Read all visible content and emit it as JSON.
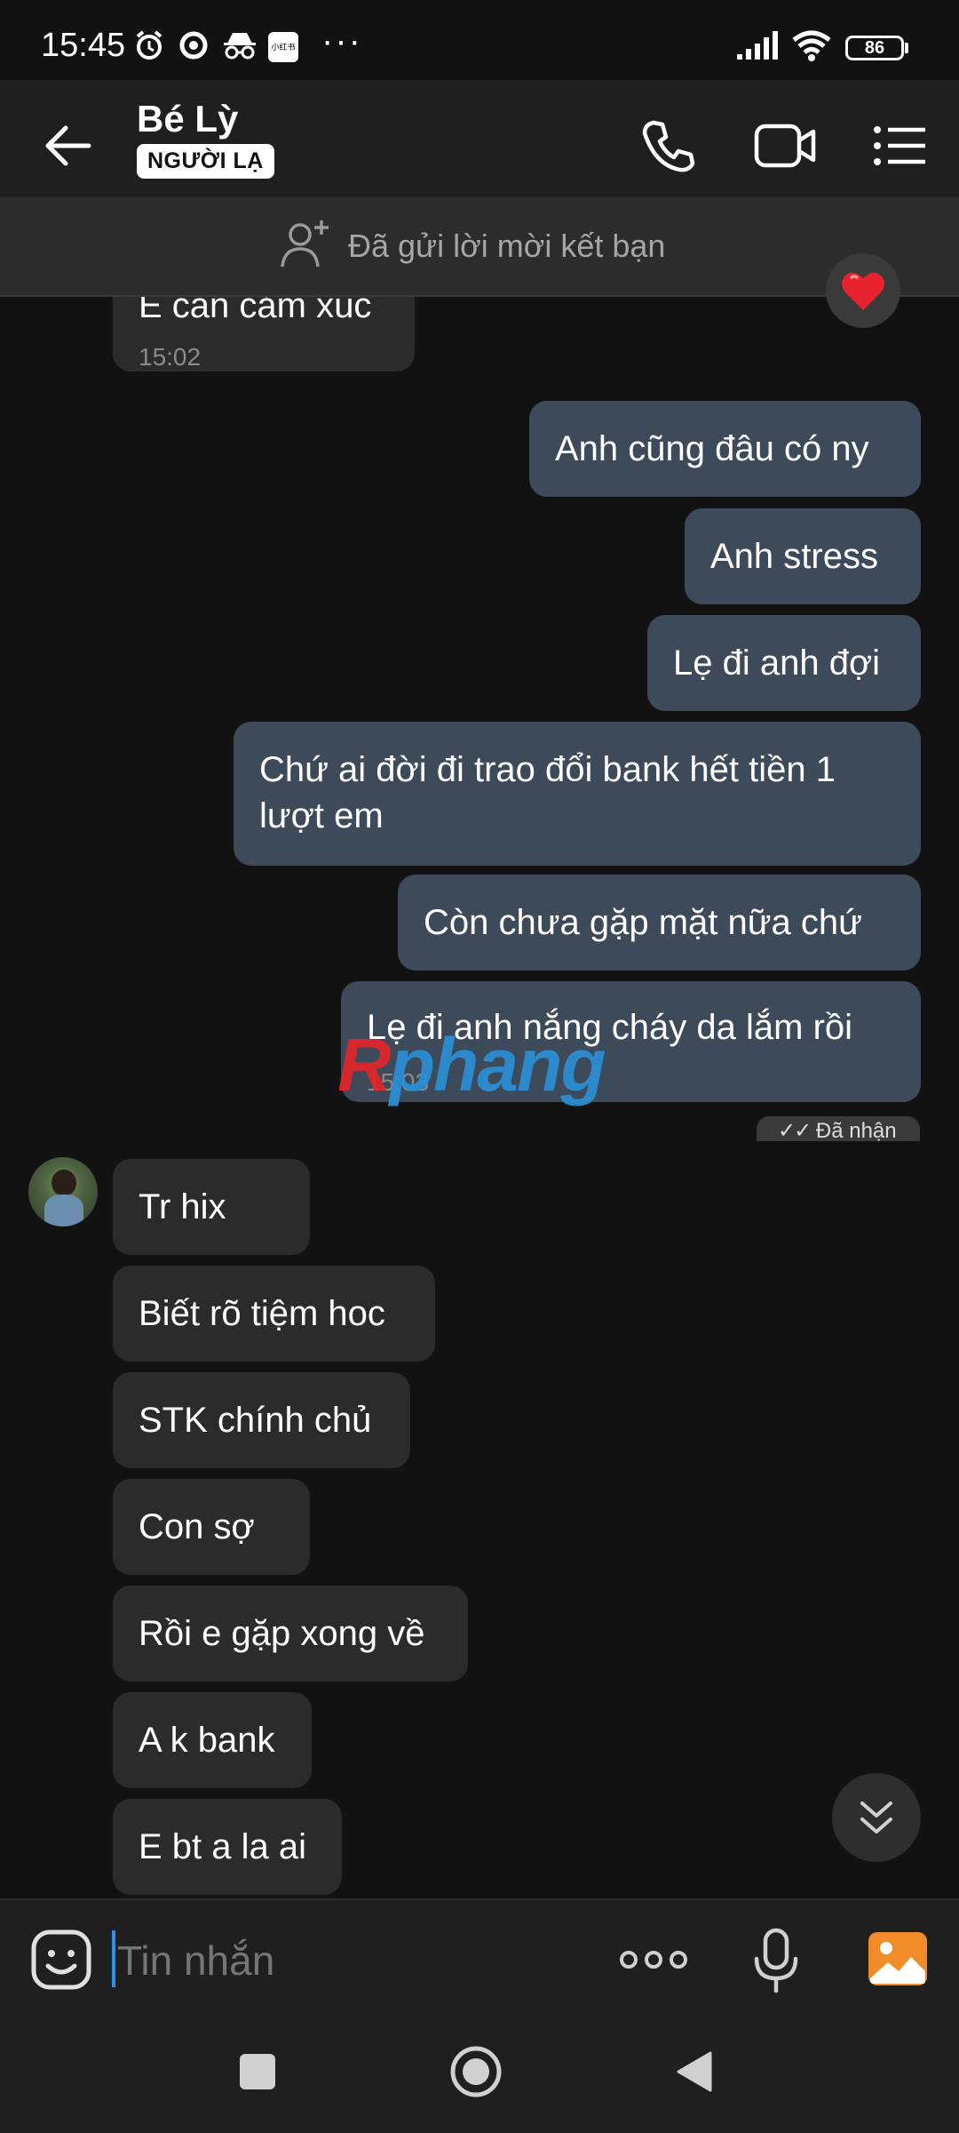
{
  "status_bar": {
    "time": "15:45",
    "battery": "86",
    "notification_badge": "小红书",
    "icons": [
      "alarm-icon",
      "sync-icon",
      "incognito-icon",
      "app-notification-icon",
      "more-dots-icon",
      "signal-icon",
      "wifi-icon",
      "battery-icon"
    ]
  },
  "header": {
    "contact_name": "Bé Lỳ",
    "badge": "NGƯỜI LẠ"
  },
  "banner": {
    "text": "Đã gửi lời mời kết bạn"
  },
  "messages": {
    "m0": {
      "text": "E cần cảm xúc",
      "time": "15:02"
    },
    "m1": {
      "text": "Anh cũng đâu có ny"
    },
    "m2": {
      "text": "Anh stress"
    },
    "m3": {
      "text": "Lẹ đi anh đợi"
    },
    "m4": {
      "text": "Chứ ai đời đi trao đổi bank hết tiền 1 lượt em"
    },
    "m5": {
      "text": "Còn chưa gặp mặt nữa chứ"
    },
    "m6": {
      "text": "Lẹ đi anh nắng cháy da lắm rồi",
      "time": "15:03"
    },
    "seen": "Đã nhận",
    "m7": {
      "text": "Tr hix"
    },
    "m8": {
      "text": "Biết rõ tiệm hoc"
    },
    "m9": {
      "text": "STK chính chủ"
    },
    "m10": {
      "text": "Con sợ"
    },
    "m11": {
      "text": "Rồi e gặp xong về"
    },
    "m12": {
      "text": "A k bank"
    },
    "m13": {
      "text": "E bt a la ai"
    }
  },
  "watermark": {
    "r": "R",
    "rest": "phang"
  },
  "input": {
    "placeholder": "Tin nhắn"
  },
  "colors": {
    "background": "#121212",
    "sent_bubble": "#3d4a5a",
    "received_bubble": "#2b2b2b",
    "accent": "#2e8ff0",
    "image_button": "#f28c28"
  }
}
